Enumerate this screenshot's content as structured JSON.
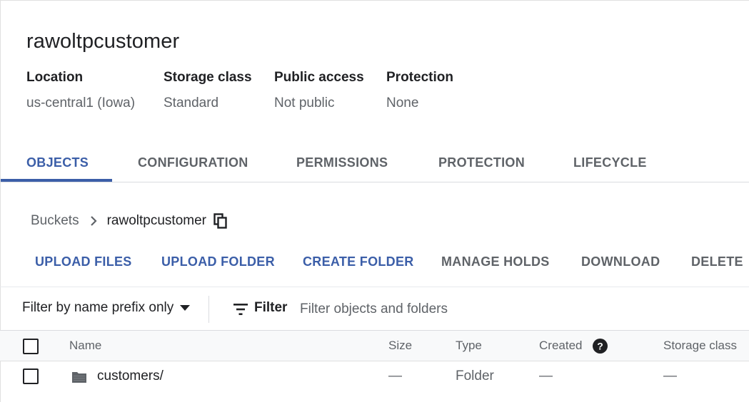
{
  "bucket": {
    "name": "rawoltpcustomer"
  },
  "meta": [
    {
      "label": "Location",
      "value": "us-central1 (Iowa)"
    },
    {
      "label": "Storage class",
      "value": "Standard"
    },
    {
      "label": "Public access",
      "value": "Not public"
    },
    {
      "label": "Protection",
      "value": "None"
    }
  ],
  "tabs": [
    {
      "label": "OBJECTS",
      "active": true
    },
    {
      "label": "CONFIGURATION",
      "active": false
    },
    {
      "label": "PERMISSIONS",
      "active": false
    },
    {
      "label": "PROTECTION",
      "active": false
    },
    {
      "label": "LIFECYCLE",
      "active": false
    }
  ],
  "breadcrumb": {
    "root": "Buckets",
    "current": "rawoltpcustomer",
    "copy_icon": "copy-icon",
    "separator_icon": "chevron-right-icon"
  },
  "actions": [
    {
      "label": "UPLOAD FILES",
      "style": "primary"
    },
    {
      "label": "UPLOAD FOLDER",
      "style": "primary"
    },
    {
      "label": "CREATE FOLDER",
      "style": "primary"
    },
    {
      "label": "MANAGE HOLDS",
      "style": "secondary"
    },
    {
      "label": "DOWNLOAD",
      "style": "secondary"
    },
    {
      "label": "DELETE",
      "style": "secondary"
    }
  ],
  "filter": {
    "mode_label": "Filter by name prefix only",
    "button_label": "Filter",
    "placeholder": "Filter objects and folders",
    "value": ""
  },
  "table": {
    "columns": [
      "Name",
      "Size",
      "Type",
      "Created",
      "Storage class"
    ],
    "rows": [
      {
        "name": "customers/",
        "size": "—",
        "type": "Folder",
        "created": "—",
        "storage_class": "—"
      }
    ]
  },
  "colors": {
    "accent": "#3b5ea8",
    "text_primary": "#202124",
    "text_secondary": "#5f6368",
    "header_bg": "#f8f9fa"
  }
}
